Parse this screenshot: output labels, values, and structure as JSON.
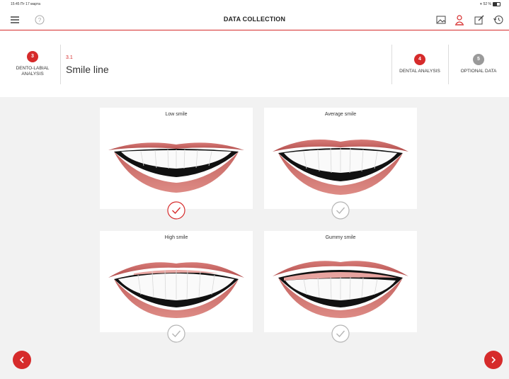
{
  "status": {
    "time_date": "15:45  Пт 17 марта",
    "battery": "52 %"
  },
  "header": {
    "title": "DATA COLLECTION"
  },
  "steps": [
    {
      "number": "3",
      "label_line1": "DENTO-LABIAL",
      "label_line2": "ANALYSIS",
      "state": "active"
    },
    {
      "number": "4",
      "label_line1": "DENTAL ANALYSIS",
      "label_line2": "",
      "state": "active"
    },
    {
      "number": "5",
      "label_line1": "OPTIONAL DATA",
      "label_line2": "",
      "state": "inactive"
    }
  ],
  "section": {
    "number": "3.1",
    "title": "Smile line"
  },
  "options": [
    {
      "label": "Low smile",
      "selected": true
    },
    {
      "label": "Average smile",
      "selected": false
    },
    {
      "label": "High smile",
      "selected": false
    },
    {
      "label": "Gummy smile",
      "selected": false
    }
  ],
  "colors": {
    "accent": "#d62b2b",
    "inactive": "#9a9a9a",
    "check_unselected": "#b5b5b5"
  },
  "icons": [
    "menu-icon",
    "help-icon",
    "image-icon",
    "patient-icon",
    "edit-icon",
    "history-icon",
    "chevron-left-icon",
    "chevron-right-icon",
    "check-icon"
  ]
}
